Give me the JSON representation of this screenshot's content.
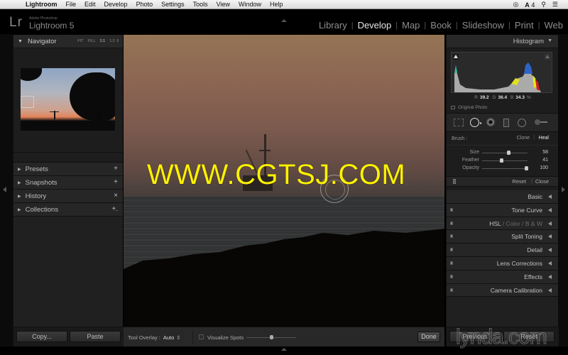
{
  "menubar": {
    "apple_icon": "apple-icon",
    "app_name": "Lightroom",
    "items": [
      "File",
      "Edit",
      "Develop",
      "Photo",
      "Settings",
      "Tools",
      "View",
      "Window",
      "Help"
    ],
    "status": {
      "cc_icon": "creative-cloud-icon",
      "adobe_badge": "4",
      "search_icon": "spotlight-search-icon",
      "list_icon": "notification-list-icon"
    }
  },
  "header": {
    "logo": "Lr",
    "brand_sub": "Adobe Photoshop",
    "brand_name": "Lightroom 5",
    "modules": [
      {
        "label": "Library",
        "active": false
      },
      {
        "label": "Develop",
        "active": true
      },
      {
        "label": "Map",
        "active": false
      },
      {
        "label": "Book",
        "active": false
      },
      {
        "label": "Slideshow",
        "active": false
      },
      {
        "label": "Print",
        "active": false
      },
      {
        "label": "Web",
        "active": false
      }
    ],
    "separator": "|"
  },
  "left_panel": {
    "navigator": {
      "title": "Navigator",
      "zoom_options": [
        "FIT",
        "FILL",
        "1:1",
        "1:2 ⇕"
      ],
      "selected_zoom": "1:1"
    },
    "sections": [
      {
        "label": "Presets",
        "action": "+"
      },
      {
        "label": "Snapshots",
        "action": "+"
      },
      {
        "label": "History",
        "action": "×"
      },
      {
        "label": "Collections",
        "action": "+."
      }
    ],
    "buttons": {
      "copy": "Copy...",
      "paste": "Paste"
    }
  },
  "image": {
    "watermark": "WWW.CGTSJ.COM"
  },
  "toolbar": {
    "tool_overlay_label": "Tool Overlay :",
    "tool_overlay_value": "Auto",
    "updown": "⇕",
    "visualize_spots_label": "Visualize Spots",
    "visualize_spots_checked": false,
    "visualize_threshold": 0.5,
    "done": "Done"
  },
  "right_panel": {
    "histogram": {
      "title": "Histogram",
      "r_label": "R",
      "r_value": "39.2",
      "g_label": "G",
      "g_value": "36.4",
      "b_label": "B",
      "b_value": "34.3",
      "percent": "%",
      "original_photo": "Original Photo"
    },
    "tools": [
      "crop-overlay",
      "spot-removal",
      "red-eye",
      "graduated-filter",
      "radial-filter",
      "adjustment-brush"
    ],
    "brush": {
      "label": "Brush :",
      "clone": "Clone",
      "heal": "Heal",
      "active": "Heal"
    },
    "sliders": [
      {
        "label": "Size",
        "value": 58,
        "fraction": 0.58
      },
      {
        "label": "Feather",
        "value": 41,
        "fraction": 0.41
      },
      {
        "label": "Opacity",
        "value": 100,
        "fraction": 1.0
      }
    ],
    "reset": "Reset",
    "close": "Close",
    "sections": [
      {
        "label": "Basic"
      },
      {
        "label": "Tone Curve"
      },
      {
        "label": "HSL",
        "extra": " / Color / B & W"
      },
      {
        "label": "Split Toning"
      },
      {
        "label": "Detail"
      },
      {
        "label": "Lens Corrections"
      },
      {
        "label": "Effects"
      },
      {
        "label": "Camera Calibration"
      }
    ],
    "bottom_buttons": {
      "previous": "Previous",
      "reset": "Reset"
    }
  },
  "watermark_brand": "lynda.com"
}
